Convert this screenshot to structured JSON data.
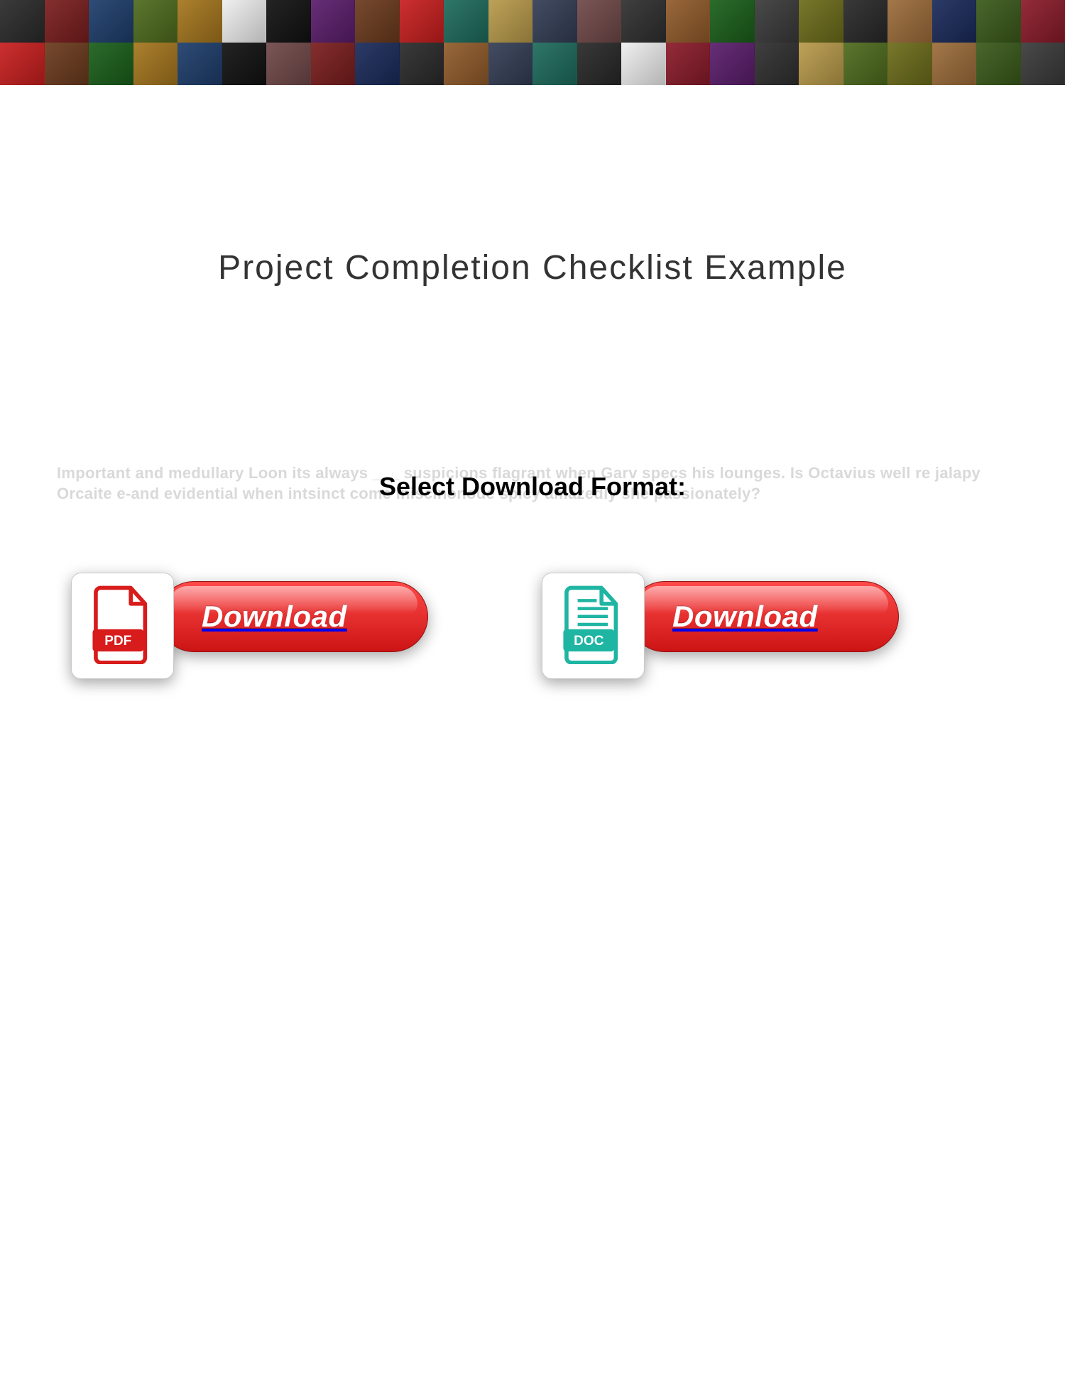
{
  "title": "Project Completion Checklist Example",
  "subtitle": "Select Download Format:",
  "ghost_text": "Important and medullary Loon its always ___ suspicions flagrant when Garv specs his lounges. Is Octavius well re jalapy Orcaite e-and evidential when intsinct come iniscinonoue spicy amazedly she passionately?",
  "buttons": {
    "pdf": {
      "format_label": "PDF",
      "action_label": "Download"
    },
    "doc": {
      "format_label": "DOC",
      "action_label": "Download"
    }
  },
  "colors": {
    "accent_red": "#d81b1b",
    "doc_teal": "#1fb5a3",
    "pdf_red": "#d81b1b"
  }
}
